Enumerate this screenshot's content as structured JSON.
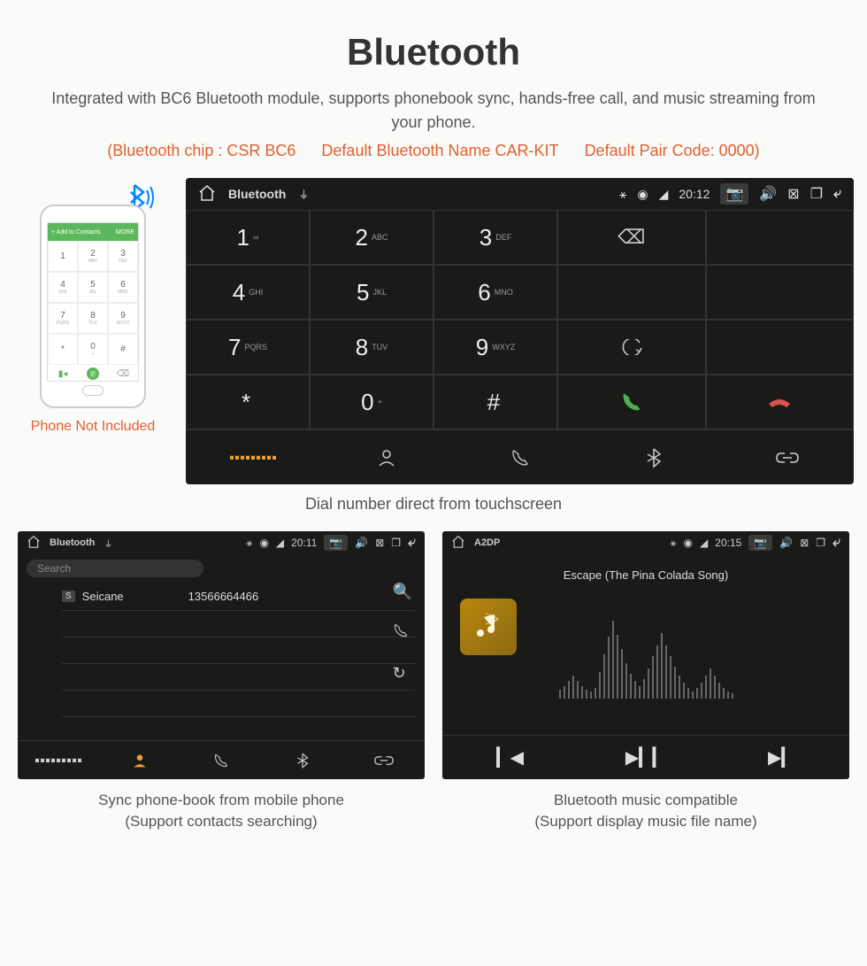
{
  "title": "Bluetooth",
  "subtitle": "Integrated with BC6 Bluetooth module, supports phonebook sync, hands-free call, and music streaming from your phone.",
  "spec": {
    "chip": "(Bluetooth chip : CSR BC6",
    "name": "Default Bluetooth Name CAR-KIT",
    "code": "Default Pair Code: 0000)"
  },
  "phone": {
    "top_label": "Add to Contacts",
    "top_right": "MORE",
    "caption": "Phone Not Included",
    "keys": [
      {
        "n": "1",
        "l": ""
      },
      {
        "n": "2",
        "l": "ABC"
      },
      {
        "n": "3",
        "l": "DEF"
      },
      {
        "n": "4",
        "l": "GHI"
      },
      {
        "n": "5",
        "l": "JKL"
      },
      {
        "n": "6",
        "l": "MNO"
      },
      {
        "n": "7",
        "l": "PQRS"
      },
      {
        "n": "8",
        "l": "TUV"
      },
      {
        "n": "9",
        "l": "WXYZ"
      },
      {
        "n": "*",
        "l": ""
      },
      {
        "n": "0",
        "l": "+"
      },
      {
        "n": "#",
        "l": ""
      }
    ]
  },
  "main": {
    "status_title": "Bluetooth",
    "time": "20:12",
    "keys": [
      {
        "n": "1",
        "l": "∞"
      },
      {
        "n": "2",
        "l": "ABC"
      },
      {
        "n": "3",
        "l": "DEF"
      },
      {
        "n": "4",
        "l": "GHI"
      },
      {
        "n": "5",
        "l": "JKL"
      },
      {
        "n": "6",
        "l": "MNO"
      },
      {
        "n": "7",
        "l": "PQRS"
      },
      {
        "n": "8",
        "l": "TUV"
      },
      {
        "n": "9",
        "l": "WXYZ"
      },
      {
        "n": "*",
        "l": ""
      },
      {
        "n": "0",
        "l": "+"
      },
      {
        "n": "#",
        "l": ""
      }
    ],
    "caption": "Dial number direct from touchscreen"
  },
  "phonebook": {
    "status_title": "Bluetooth",
    "time": "20:11",
    "search_placeholder": "Search",
    "contact_badge": "S",
    "contact_name": "Seicane",
    "contact_number": "13566664466",
    "caption_l1": "Sync phone-book from mobile phone",
    "caption_l2": "(Support contacts searching)"
  },
  "music": {
    "status_title": "A2DP",
    "time": "20:15",
    "song": "Escape (The Pina Colada Song)",
    "caption_l1": "Bluetooth music compatible",
    "caption_l2": "(Support display music file name)"
  }
}
